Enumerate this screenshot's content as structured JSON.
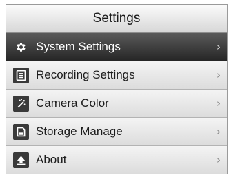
{
  "header": {
    "title": "Settings"
  },
  "menu": {
    "items": [
      {
        "label": "System Settings",
        "icon": "gear-icon",
        "chevron": "›",
        "selected": true
      },
      {
        "label": "Recording Settings",
        "icon": "recording-icon",
        "chevron": "›",
        "selected": false
      },
      {
        "label": "Camera Color",
        "icon": "camera-color-icon",
        "chevron": "›",
        "selected": false
      },
      {
        "label": "Storage Manage",
        "icon": "storage-icon",
        "chevron": "›",
        "selected": false
      },
      {
        "label": "About",
        "icon": "about-icon",
        "chevron": "›",
        "selected": false
      }
    ]
  },
  "colors": {
    "selected_bg": "#3a3a3a",
    "item_bg": "#e6e6e6"
  }
}
